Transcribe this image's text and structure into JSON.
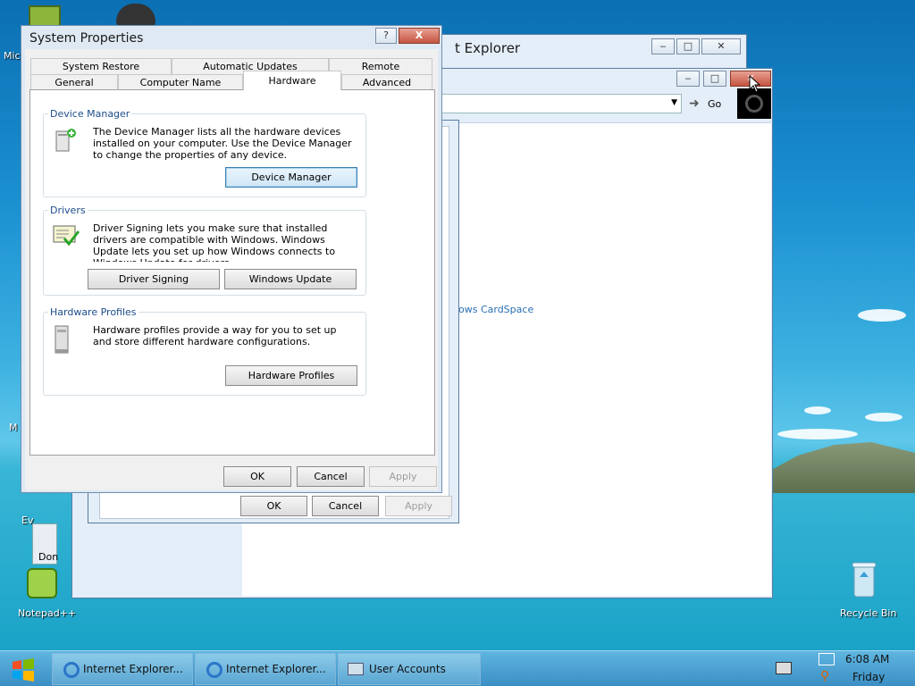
{
  "desktop": {
    "icons": [
      {
        "label": "Mic"
      },
      {
        "label": "M"
      },
      {
        "label": "Ev"
      },
      {
        "label": "Notepad++"
      },
      {
        "label": "Recycle Bin"
      }
    ]
  },
  "ie_window": {
    "title": "t Explorer",
    "go_label": "Go",
    "link_text": "ows CardSpace",
    "partial_text": "Don"
  },
  "user_accounts_dialog": {
    "ok": "OK",
    "cancel": "Cancel",
    "apply": "Apply"
  },
  "system_properties": {
    "title": "System Properties",
    "help_btn": "?",
    "close_btn": "X",
    "tabs_row1": [
      "System Restore",
      "Automatic Updates",
      "Remote"
    ],
    "tabs_row2": [
      "General",
      "Computer Name",
      "Hardware",
      "Advanced"
    ],
    "device_manager": {
      "title": "Device Manager",
      "text": "The Device Manager lists all the hardware devices installed on your computer. Use the Device Manager to change the properties of any device.",
      "button": "Device Manager"
    },
    "drivers": {
      "title": "Drivers",
      "text": "Driver Signing lets you make sure that installed drivers are compatible with Windows. Windows Update lets you set up how Windows connects to Windows Update for drivers.",
      "signing_button": "Driver Signing",
      "update_button": "Windows Update"
    },
    "hardware_profiles": {
      "title": "Hardware Profiles",
      "text": "Hardware profiles provide a way for you to set up and store different hardware configurations.",
      "button": "Hardware Profiles"
    },
    "ok": "OK",
    "cancel": "Cancel",
    "apply": "Apply"
  },
  "taskbar": {
    "items": [
      {
        "label": "Internet Explorer..."
      },
      {
        "label": "Internet Explorer..."
      },
      {
        "label": "User Accounts"
      }
    ],
    "time": "6:08 AM",
    "day": "Friday"
  }
}
